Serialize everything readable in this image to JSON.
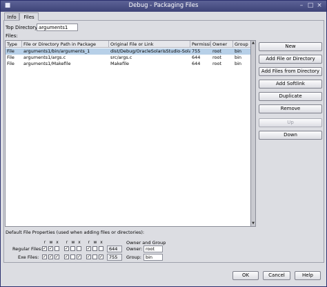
{
  "window": {
    "title": "Debug - Packaging Files"
  },
  "tabs": [
    {
      "label": "Info"
    },
    {
      "label": "Files"
    }
  ],
  "top_directory": {
    "label": "Top Directory:",
    "value": "arguments1"
  },
  "files_label": "Files:",
  "table": {
    "headers": [
      "Type",
      "File or Directory Path in Package",
      "Original File or Link",
      "Permissi...",
      "Owner",
      "Group"
    ],
    "rows": [
      [
        "File",
        "arguments1/bin/arguments_1",
        "dist/Debug/OracleSolarisStudio-Solari...",
        "755",
        "root",
        "bin"
      ],
      [
        "File",
        "arguments1/args.c",
        "src/args.c",
        "644",
        "root",
        "bin"
      ],
      [
        "File",
        "arguments1/Makefile",
        "Makefile",
        "644",
        "root",
        "bin"
      ]
    ]
  },
  "buttons": {
    "new": "New",
    "add_file_or_directory": "Add File or Directory",
    "add_files_from_directory": "Add Files from Directory",
    "add_softlink": "Add Softlink",
    "duplicate": "Duplicate",
    "remove": "Remove",
    "up": "Up",
    "down": "Down"
  },
  "default_props": {
    "title": "Default File Properties (used when adding files or directories):",
    "owner_group_title": "Owner and Group",
    "regular_label": "Regular Files:",
    "exe_label": "Exe Files:",
    "perm_letters": [
      "r",
      "w",
      "x"
    ],
    "regular_perm": "644",
    "exe_perm": "755",
    "owner_label": "Owner:",
    "owner_value": "root",
    "group_label": "Group:",
    "group_value": "bin"
  },
  "footer": {
    "ok": "OK",
    "cancel": "Cancel",
    "help": "Help"
  }
}
